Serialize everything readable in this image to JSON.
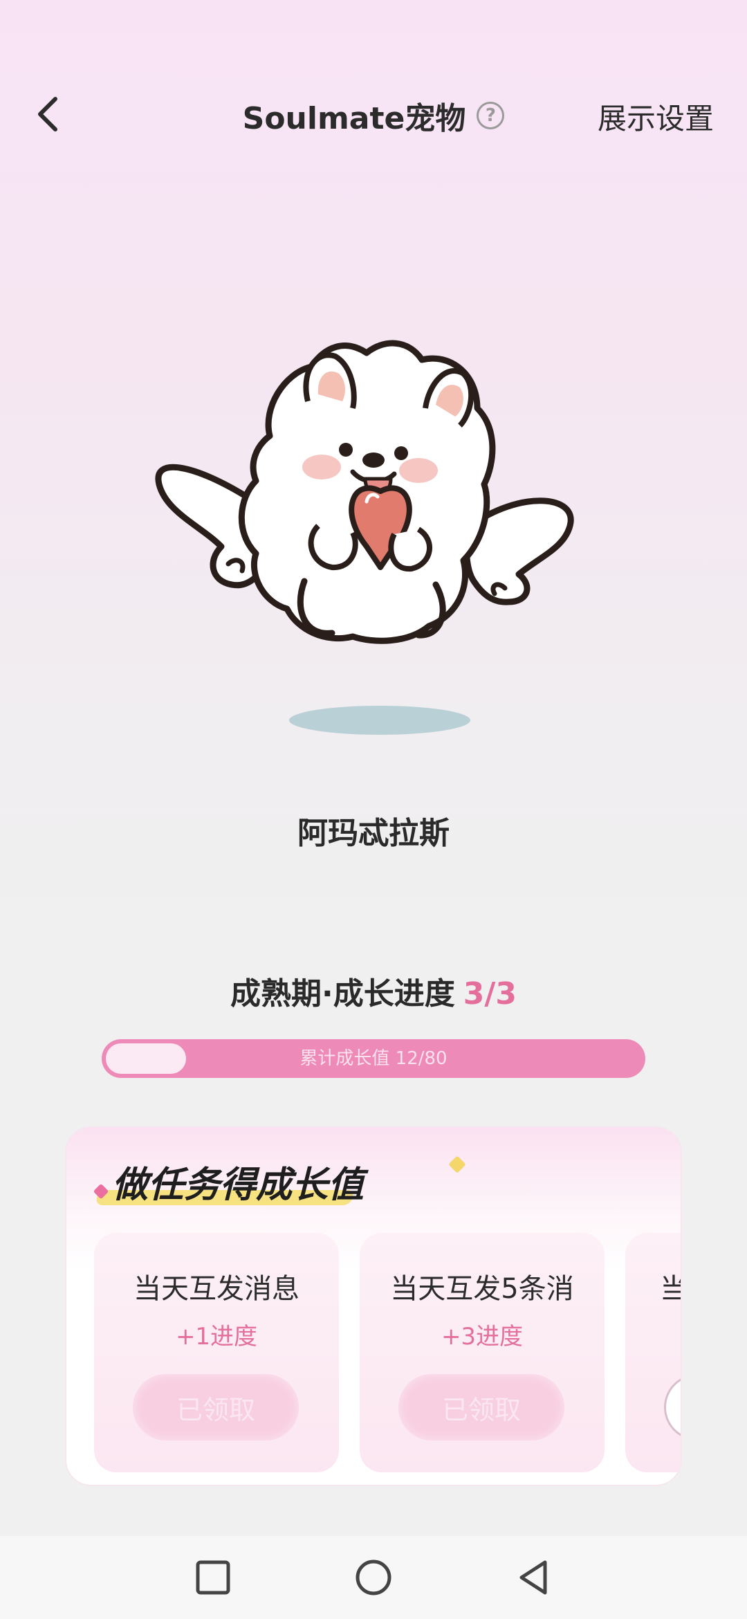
{
  "header": {
    "title": "Soulmate宠物",
    "help_symbol": "?",
    "display_settings": "展示设置"
  },
  "pet": {
    "name": "阿玛忒拉斯"
  },
  "growth": {
    "stage_label": "成熟期·成长进度",
    "stage_progress": "3/3",
    "bar_text": "累计成长值 12/80",
    "bar_fraction": 0.15
  },
  "tasks": {
    "title": "做任务得成长值",
    "items": [
      {
        "name": "当天互发消息",
        "gain": "+1进度",
        "button": "已领取"
      },
      {
        "name": "当天互发5条消",
        "gain": "+3进度",
        "button": "已领取"
      },
      {
        "name": "当"
      }
    ]
  },
  "colors": {
    "accent_pink": "#e46f9c",
    "bar_pink": "#ee8ab7",
    "shadow": "#b9d0d6"
  }
}
